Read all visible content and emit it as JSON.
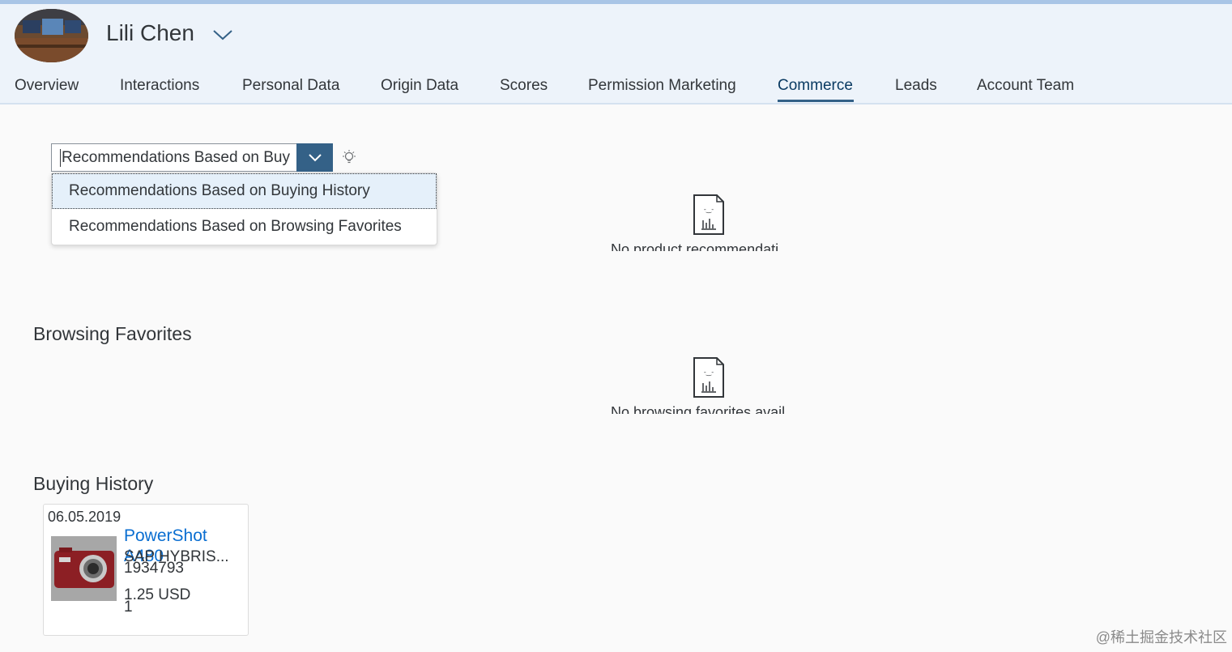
{
  "header": {
    "user_name": "Lili Chen"
  },
  "tabs": [
    {
      "label": "Overview"
    },
    {
      "label": "Interactions"
    },
    {
      "label": "Personal Data"
    },
    {
      "label": "Origin Data"
    },
    {
      "label": "Scores"
    },
    {
      "label": "Permission Marketing"
    },
    {
      "label": "Commerce",
      "active": true
    },
    {
      "label": "Leads"
    },
    {
      "label": "Account Team"
    }
  ],
  "recommendation_select": {
    "value": "Recommendations Based on Buy",
    "options": [
      "Recommendations Based on Buying History",
      "Recommendations Based on Browsing Favorites"
    ]
  },
  "recommendations": {
    "empty_text": "No product recommendati"
  },
  "browsing_favorites": {
    "title": "Browsing Favorites",
    "empty_text": "No browsing favorites avail"
  },
  "buying_history": {
    "title": "Buying History",
    "items": [
      {
        "date": "06.05.2019",
        "product_name": "PowerShot A480",
        "vendor": "SAP HYBRIS...",
        "product_id": "1934793",
        "price": "1.25 USD",
        "quantity": "1"
      }
    ]
  },
  "watermark": "@稀土掘金技术社区",
  "colors": {
    "accent": "#346187",
    "link": "#0a6ed1",
    "header_bg": "#edf3fa",
    "selected_item_bg": "#e5f0fa"
  }
}
